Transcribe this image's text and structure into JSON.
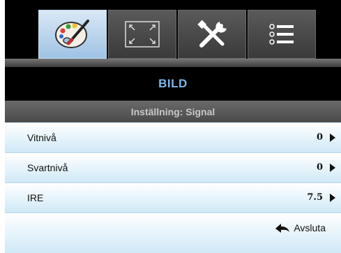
{
  "tabs": [
    {
      "icon": "palette-icon",
      "active": true
    },
    {
      "icon": "display-resize-icon",
      "active": false
    },
    {
      "icon": "tools-icon",
      "active": false
    },
    {
      "icon": "options-list-icon",
      "active": false
    }
  ],
  "menu": {
    "title": "BILD",
    "subtitle": "Inställning: Signal",
    "items": [
      {
        "label": "Vitnivå",
        "value": "0"
      },
      {
        "label": "Svartnivå",
        "value": "0"
      },
      {
        "label": "IRE",
        "value": "7.5"
      }
    ],
    "exit_label": "Avsluta"
  },
  "colors": {
    "title": "#7db7ea",
    "active_tab": "#c0d9ef",
    "row_gradient_end": "#cfe8f6"
  }
}
